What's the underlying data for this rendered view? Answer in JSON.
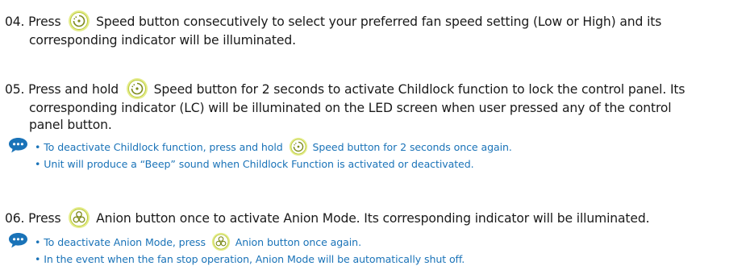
{
  "colors": {
    "body_text": "#1a1a1a",
    "note_text": "#1a73b8",
    "icon_ring": "#c9d94a",
    "bubble": "#1a73b8"
  },
  "icons": {
    "speed": "speed-button-icon",
    "anion": "anion-button-icon",
    "note": "speech-bubble-icon"
  },
  "steps": [
    {
      "number": "04.",
      "before": "Press",
      "line1": "Speed button consecutively to select your preferred fan speed setting (Low or High) and its",
      "line2": "corresponding indicator will be illuminated."
    },
    {
      "number": "05.",
      "before": "Press and hold",
      "line1": "Speed button for 2 seconds to activate Childlock function to lock the control panel. Its",
      "line2": "corresponding indicator (LC) will be illuminated on the LED screen when user pressed any of the control",
      "line3": "panel button.",
      "notes": {
        "n1_before": "• To deactivate Childlock function, press and hold",
        "n1_after": "Speed button for 2 seconds once again.",
        "n2": "• Unit will produce a “Beep” sound when Childlock Function is activated or deactivated."
      }
    },
    {
      "number": "06.",
      "before": "Press",
      "line1": "Anion button once to activate Anion Mode. Its corresponding indicator will be illuminated.",
      "notes": {
        "n1_before": "• To deactivate Anion Mode, press",
        "n1_after": "Anion button once again.",
        "n2": "• In the event when the fan stop operation, Anion Mode will be automatically shut off."
      }
    }
  ]
}
